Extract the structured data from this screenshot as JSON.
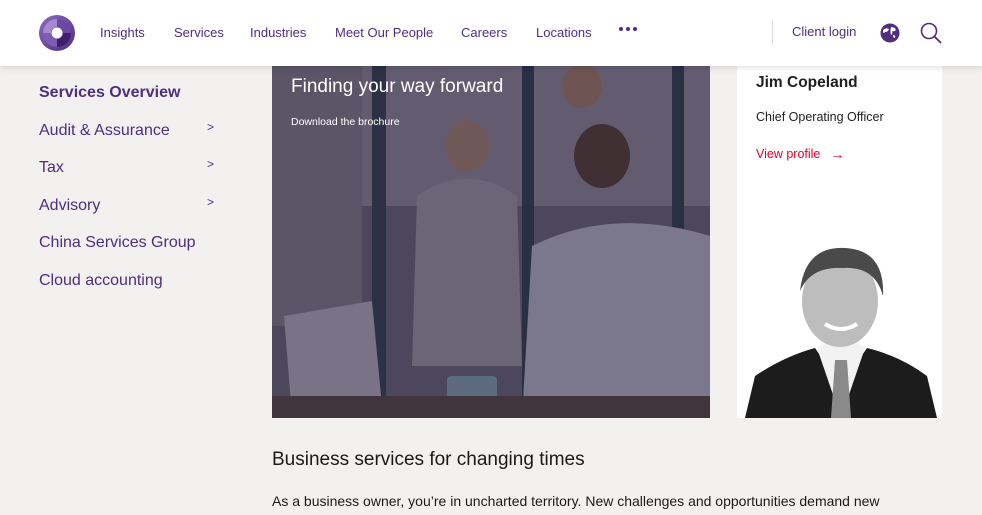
{
  "header": {
    "nav": [
      {
        "label": "Insights"
      },
      {
        "label": "Services"
      },
      {
        "label": "Industries"
      },
      {
        "label": "Meet Our People"
      },
      {
        "label": "Careers"
      },
      {
        "label": "Locations"
      }
    ],
    "more_icon": "more-dots-icon",
    "client_login": "Client login",
    "globe_icon": "globe-icon",
    "search_icon": "search-icon"
  },
  "colors": {
    "brand": "#4f2d7f",
    "accent": "#de002e",
    "background": "#f2f1ef"
  },
  "sidebar": {
    "items": [
      {
        "label": "Services Overview",
        "active": true,
        "has_children": false
      },
      {
        "label": "Audit & Assurance",
        "has_children": true
      },
      {
        "label": "Tax",
        "has_children": true
      },
      {
        "label": "Advisory",
        "has_children": true
      },
      {
        "label": "China Services Group",
        "has_children": false
      },
      {
        "label": "Cloud accounting",
        "has_children": false
      }
    ],
    "chevron": ">"
  },
  "hero": {
    "title": "Finding your way forward",
    "link": "Download the brochure"
  },
  "contact_card": {
    "name": "Jim Copeland",
    "role": "Chief Operating Officer",
    "link": "View profile",
    "arrow": "→"
  },
  "main": {
    "section_title": "Business services for changing times",
    "intro": "As a business owner, you’re in uncharted territory. New challenges and opportunities demand new"
  }
}
